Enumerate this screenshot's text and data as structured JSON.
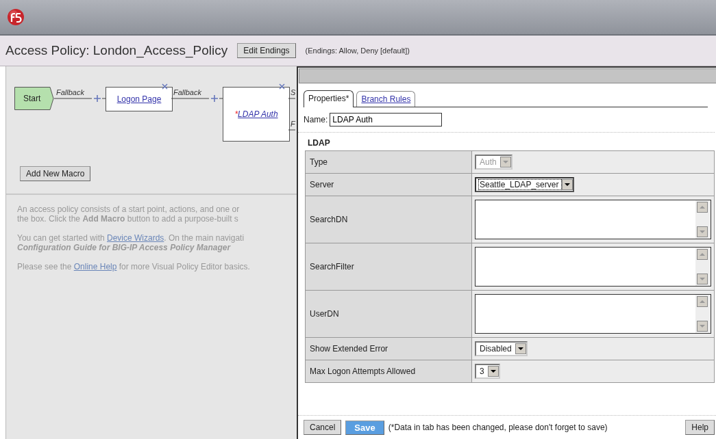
{
  "header": {
    "title": "Access Policy: London_Access_Policy",
    "edit_button": "Edit Endings",
    "endings_note": "(Endings: Allow, Deny [default])"
  },
  "diagram": {
    "nodes": [
      {
        "kind": "start",
        "label": "Start",
        "branches": [
          "Fallback"
        ]
      },
      {
        "kind": "action",
        "label": "Logon Page",
        "branches": [
          "Fallback"
        ]
      },
      {
        "kind": "action",
        "label": "LDAP Auth",
        "marker": "*",
        "branches": [
          "S",
          "F"
        ]
      }
    ]
  },
  "add_macro_button": "Add New Macro",
  "help": [
    {
      "lines": [
        [
          {
            "kind": "text",
            "text": "An access policy consists of a start point, actions, and one or"
          }
        ],
        [
          {
            "kind": "text",
            "text": "the box. Click the **Add Macro** button to add a purpose-built s"
          }
        ]
      ]
    },
    {
      "lines": [
        [
          {
            "kind": "text",
            "text": "You can get started with "
          },
          {
            "kind": "link",
            "text": "Device Wizards"
          },
          {
            "kind": "text",
            "text": ". On the main navigati"
          }
        ],
        [
          {
            "kind": "emphasis",
            "text": "Configuration Guide for BIG-IP Access Policy Manager"
          }
        ]
      ]
    },
    {
      "lines": [
        [
          {
            "kind": "text",
            "text": "Please see the "
          },
          {
            "kind": "link",
            "text": "Online Help"
          },
          {
            "kind": "text",
            "text": " for more Visual Policy Editor basics."
          }
        ]
      ]
    }
  ],
  "dialog": {
    "tabs": [
      {
        "label": "Properties*",
        "selected": true
      },
      {
        "label": "Branch Rules",
        "selected": false
      }
    ],
    "name_label": "Name:",
    "name_value": "LDAP Auth",
    "section": "LDAP",
    "fields": [
      {
        "label": "Type",
        "kind": "select",
        "value": "Auth",
        "disabled": true,
        "focused": false
      },
      {
        "label": "Server",
        "kind": "select",
        "value": "Seattle_LDAP_server",
        "disabled": false,
        "focused": true
      },
      {
        "label": "SearchDN",
        "kind": "textarea"
      },
      {
        "label": "SearchFilter",
        "kind": "textarea"
      },
      {
        "label": "UserDN",
        "kind": "textarea"
      },
      {
        "label": "Show Extended Error",
        "kind": "select",
        "value": "Disabled",
        "disabled": false,
        "focused": false
      },
      {
        "label": "Max Logon Attempts Allowed",
        "kind": "select",
        "value": "3",
        "disabled": false,
        "focused": false
      }
    ],
    "footer": {
      "cancel": "Cancel",
      "save": "Save",
      "note": "(*Data in tab has been changed, please don't forget to save)",
      "help": "Help"
    }
  }
}
